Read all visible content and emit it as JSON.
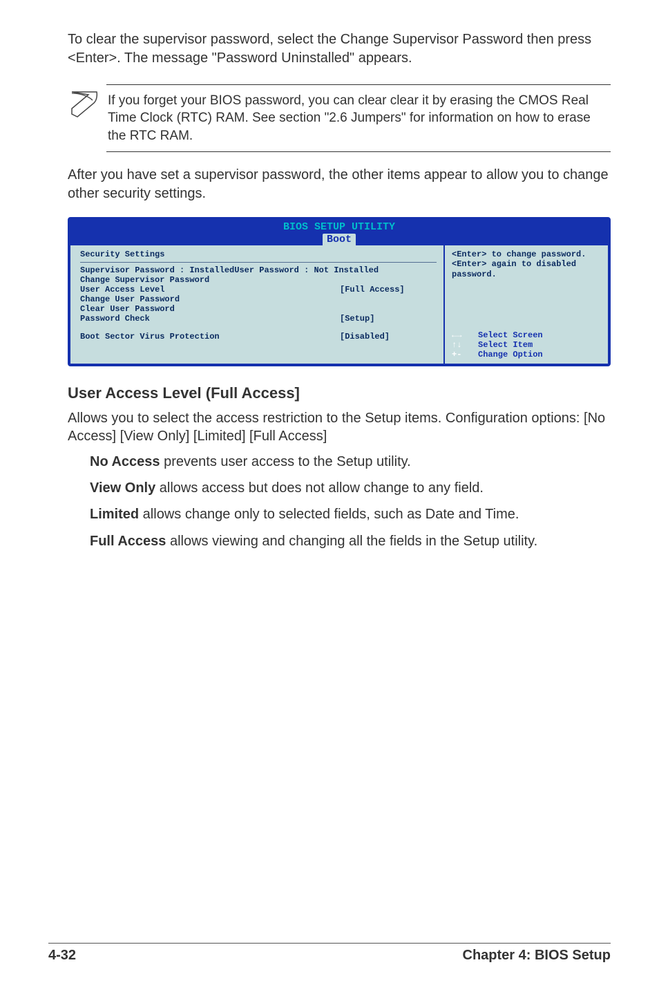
{
  "para1": "To clear the supervisor password, select the Change Supervisor Password then press <Enter>. The message \"Password Uninstalled\" appears.",
  "note": "If you forget your BIOS password, you can clear clear it by erasing the CMOS Real Time Clock (RTC) RAM. See section \"2.6  Jumpers\" for information on how to erase the RTC RAM.",
  "para2": "After you have set a supervisor password, the other items appear to allow you to change other security settings.",
  "bios": {
    "title": "BIOS SETUP UTILITY",
    "tab": "Boot",
    "section_title": "Security Settings",
    "rows": {
      "sup_label": "Supervisor Password  : Installed",
      "user_pw_label": "User Password : Not Installed",
      "change_sup": "Change Supervisor Password",
      "ual_label": "User Access Level",
      "ual_value": "[Full Access]",
      "change_user": "Change User Password",
      "clear_user": "Clear User Password",
      "pwcheck_label": "Password Check",
      "pwcheck_value": "[Setup]",
      "bootvirus_label": "Boot Sector Virus Protection",
      "bootvirus_value": "[Disabled]"
    },
    "help1": "<Enter> to change password.",
    "help2": "<Enter> again to disabled password.",
    "nav": {
      "k1": "←→",
      "a1": "Select Screen",
      "k2": "↑↓",
      "a2": "Select Item",
      "k3": "+-",
      "a3": "Change Option"
    }
  },
  "h3": "User Access Level (Full Access]",
  "body1": "Allows you to select the access restriction to the Setup items. Configuration options: [No Access] [View Only] [Limited] [Full Access]",
  "items": {
    "noaccess_b": "No Access",
    "noaccess_t": " prevents user access to the Setup utility.",
    "viewonly_b": "View Only",
    "viewonly_t": " allows access but does not allow change to any field.",
    "limited_b": "Limited",
    "limited_t": " allows change only to selected fields, such as Date and Time.",
    "full_b": "Full Access",
    "full_t": " allows viewing and changing all the fields in the Setup utility."
  },
  "footer": {
    "left": "4-32",
    "right": "Chapter 4: BIOS Setup"
  }
}
